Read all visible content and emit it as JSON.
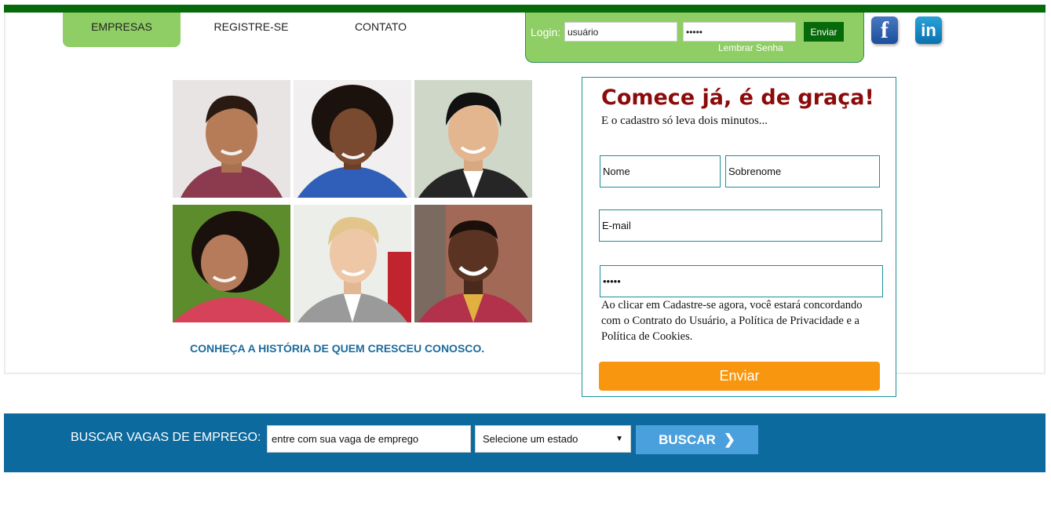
{
  "nav": {
    "items": [
      {
        "label": "EMPRESAS",
        "active": true
      },
      {
        "label": "REGISTRE-SE",
        "active": false
      },
      {
        "label": "CONTATO",
        "active": false
      }
    ]
  },
  "login": {
    "label": "Login:",
    "username_value": "usuário",
    "password_value": "•••••",
    "submit_label": "Enviar",
    "remember_label": "Lembrar Senha"
  },
  "social": {
    "facebook_glyph": "f",
    "linkedin_glyph": "in"
  },
  "gallery": {
    "photos": [
      {
        "icon": "man-portrait"
      },
      {
        "icon": "woman-portrait"
      },
      {
        "icon": "man-portrait"
      },
      {
        "icon": "woman-portrait"
      },
      {
        "icon": "man-portrait"
      },
      {
        "icon": "man-portrait"
      }
    ],
    "story_link": "CONHEÇA A HISTÓRIA DE QUEM CRESCEU CONOSCO."
  },
  "signup": {
    "title": "Comece já, é de graça!",
    "subtitle": "E o cadastro só leva dois minutos...",
    "first_name_value": "Nome",
    "last_name_value": "Sobrenome",
    "email_value": "E-mail",
    "password_value": "•••••",
    "terms": "Ao clicar em Cadastre-se agora, você estará concordando com o Contrato do Usuário, a Política de Privacidade e a Política de Cookies.",
    "submit_label": "Enviar"
  },
  "search": {
    "label": "BUSCAR VAGAS DE EMPREGO:",
    "input_value": "entre com sua vaga de emprego",
    "state_selected": "Selecione um estado",
    "button_label": "BUSCAR"
  },
  "colors": {
    "top_bar": "#076a0a",
    "nav_active": "#8fcd65",
    "title_red": "#8b0a0a",
    "teal_border": "#1a8f9c",
    "orange_button": "#f8960f",
    "search_bar": "#0d6a9e",
    "search_button": "#4aa0dc",
    "link_blue": "#1c6b9b"
  }
}
